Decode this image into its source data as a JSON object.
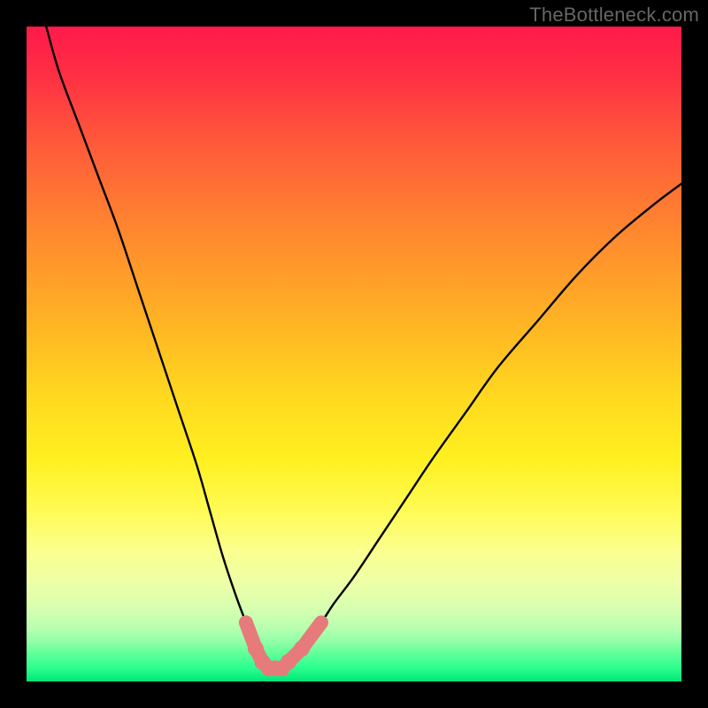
{
  "watermark": "TheBottleneck.com",
  "chart_data": {
    "type": "line",
    "title": "",
    "xlabel": "",
    "ylabel": "",
    "xlim": [
      0,
      100
    ],
    "ylim": [
      0,
      100
    ],
    "series": [
      {
        "name": "bottleneck-curve",
        "x": [
          3,
          5,
          8,
          11,
          14,
          17,
          20,
          23,
          26,
          28,
          30,
          32,
          33.5,
          35,
          36,
          37,
          38,
          39,
          40,
          42,
          45,
          47,
          50,
          54,
          58,
          62,
          67,
          72,
          78,
          84,
          90,
          96,
          100
        ],
        "y": [
          100,
          93,
          85,
          77,
          69,
          60,
          51,
          42,
          33,
          26,
          19,
          13,
          9,
          5,
          3,
          2,
          2,
          2,
          3,
          5,
          9,
          12,
          16,
          22,
          28,
          34,
          41,
          48,
          55,
          62,
          68,
          73,
          76
        ]
      },
      {
        "name": "highlight-markers",
        "x": [
          33.5,
          35,
          36,
          37,
          38,
          39,
          40,
          42,
          45
        ],
        "y": [
          9,
          5,
          3,
          2,
          2,
          2,
          3,
          5,
          9
        ]
      }
    ],
    "gradient_stops": [
      {
        "pos": 0,
        "color": "#ff1a4a"
      },
      {
        "pos": 66,
        "color": "#fff020"
      },
      {
        "pos": 100,
        "color": "#00e676"
      }
    ]
  }
}
